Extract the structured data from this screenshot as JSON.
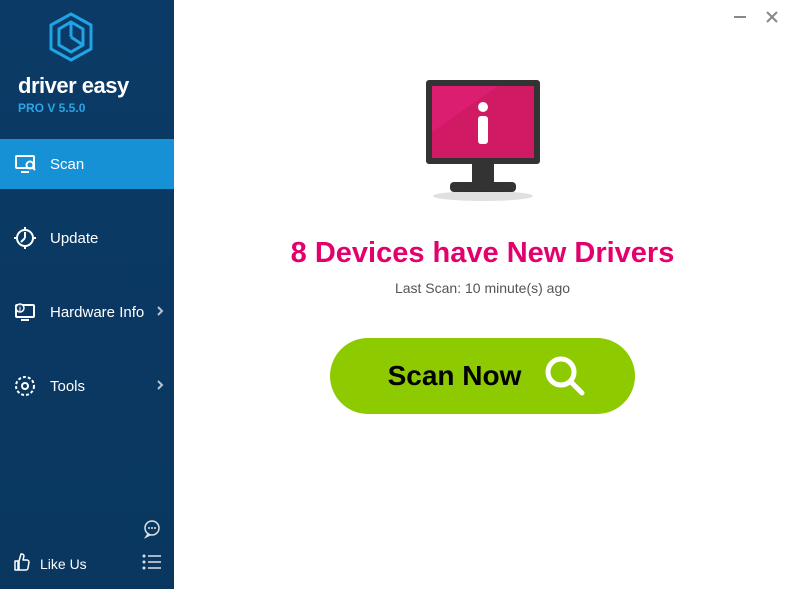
{
  "app": {
    "brand": "driver easy",
    "version": "PRO V 5.5.0"
  },
  "nav": {
    "scan": "Scan",
    "update": "Update",
    "hardware_info": "Hardware Info",
    "tools": "Tools"
  },
  "footer": {
    "like_us": "Like Us"
  },
  "main": {
    "headline": "8 Devices have New Drivers",
    "last_scan": "Last Scan: 10 minute(s) ago",
    "scan_button": "Scan Now"
  },
  "colors": {
    "accent": "#1791d6",
    "magenta": "#e3006d",
    "green": "#8dcb00",
    "sidebar": "#0b3a66"
  }
}
